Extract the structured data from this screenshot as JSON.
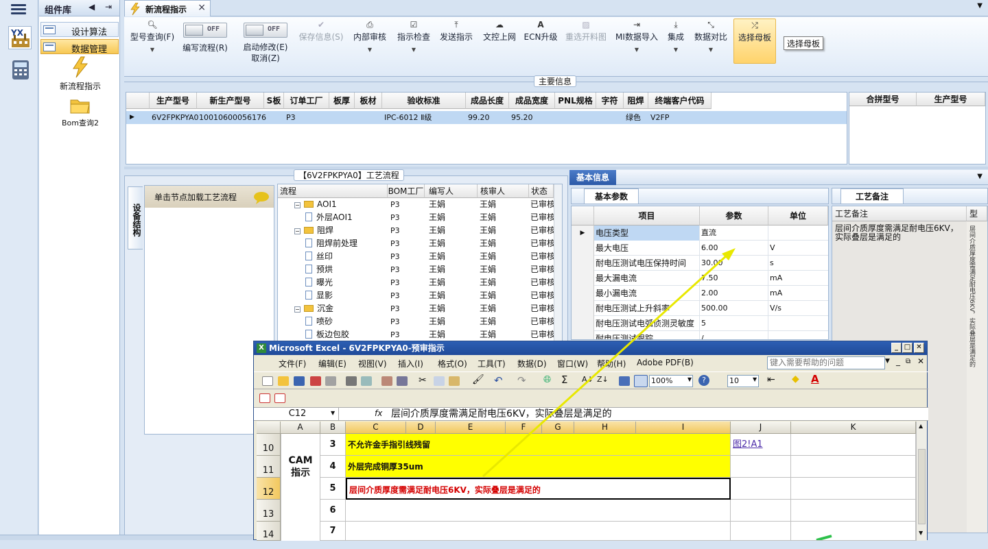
{
  "rail": {
    "icons": [
      "menu-icon",
      "yx-factory-icon",
      "calculator-icon"
    ]
  },
  "component_panel": {
    "title": "组件库",
    "items": [
      {
        "label": "设计算法"
      },
      {
        "label": "数据管理"
      }
    ],
    "tools": [
      {
        "label": "新流程指示"
      },
      {
        "label": "Bom查询2"
      }
    ]
  },
  "doc_tab": {
    "title": "新流程指示",
    "close": "×"
  },
  "ribbon": {
    "buttons": [
      {
        "label": "型号查询(F)"
      },
      {
        "label": "编写流程(R)"
      },
      {
        "label": "启动修改(E)",
        "label2": "取消(Z)"
      },
      {
        "label": "保存信息(S)"
      },
      {
        "label": "内部审核"
      },
      {
        "label": "指示检查"
      },
      {
        "label": "发送指示"
      },
      {
        "label": "文控上网"
      },
      {
        "label": "ECN升级"
      },
      {
        "label": "重选开料图"
      },
      {
        "label": "MI数据导入"
      },
      {
        "label": "集成"
      },
      {
        "label": "数据对比"
      },
      {
        "label": "选择母板"
      }
    ],
    "toggle_off": "OFF",
    "tooltip": "选择母板"
  },
  "main_info": {
    "title": "主要信息",
    "columns": [
      "生产型号",
      "新生产型号",
      "S板",
      "订单工厂",
      "板厚",
      "板材",
      "验收标准",
      "成品长度",
      "成品宽度",
      "PNL规格",
      "字符",
      "阻焊",
      "终端客户代码"
    ],
    "row": [
      "6V2FPKPYA0",
      "10010600056176",
      "",
      "P3",
      "",
      "",
      "IPC-6012 Ⅱ级",
      "99.20",
      "95.20",
      "",
      "",
      "绿色",
      "V2FP"
    ],
    "side_columns": [
      "合拼型号",
      "生产型号"
    ]
  },
  "process": {
    "title": "【6V2FPKPYA0】工艺流程",
    "side_tab": "设备结构",
    "hint": "单击节点加载工艺流程",
    "columns": [
      "流程",
      "BOM工厂",
      "编写人",
      "核审人",
      "状态"
    ],
    "rows": [
      {
        "name": "AOI1",
        "level": 0,
        "factory": "P3",
        "writer": "王娟",
        "reviewer": "王娟",
        "status": "已审核"
      },
      {
        "name": "外层AOI1",
        "level": 1,
        "factory": "P3",
        "writer": "王娟",
        "reviewer": "王娟",
        "status": "已审核"
      },
      {
        "name": "阻焊",
        "level": 0,
        "factory": "P3",
        "writer": "王娟",
        "reviewer": "王娟",
        "status": "已审核"
      },
      {
        "name": "阻焊前处理",
        "level": 1,
        "factory": "P3",
        "writer": "王娟",
        "reviewer": "王娟",
        "status": "已审核"
      },
      {
        "name": "丝印",
        "level": 1,
        "factory": "P3",
        "writer": "王娟",
        "reviewer": "王娟",
        "status": "已审核"
      },
      {
        "name": "预烘",
        "level": 1,
        "factory": "P3",
        "writer": "王娟",
        "reviewer": "王娟",
        "status": "已审核"
      },
      {
        "name": "曝光",
        "level": 1,
        "factory": "P3",
        "writer": "王娟",
        "reviewer": "王娟",
        "status": "已审核"
      },
      {
        "name": "显影",
        "level": 1,
        "factory": "P3",
        "writer": "王娟",
        "reviewer": "王娟",
        "status": "已审核"
      },
      {
        "name": "沉金",
        "level": 0,
        "factory": "P3",
        "writer": "王娟",
        "reviewer": "王娟",
        "status": "已审核"
      },
      {
        "name": "喷砂",
        "level": 1,
        "factory": "P3",
        "writer": "王娟",
        "reviewer": "王娟",
        "status": "已审核"
      },
      {
        "name": "板边包胶",
        "level": 1,
        "factory": "P3",
        "writer": "王娟",
        "reviewer": "王娟",
        "status": "已审核"
      }
    ]
  },
  "basic_info": {
    "tab": "基本信息",
    "subtab": "基本参数",
    "columns": [
      "项目",
      "参数",
      "单位"
    ],
    "rows": [
      {
        "item": "电压类型",
        "value": "直流",
        "unit": ""
      },
      {
        "item": "最大电压",
        "value": "6.00",
        "unit": "V"
      },
      {
        "item": "耐电压测试电压保持时间",
        "value": "30.00",
        "unit": "s"
      },
      {
        "item": "最大漏电流",
        "value": "7.50",
        "unit": "mA"
      },
      {
        "item": "最小漏电流",
        "value": "2.00",
        "unit": "mA"
      },
      {
        "item": "耐电压测试上升斜率",
        "value": "500.00",
        "unit": "V/s"
      },
      {
        "item": "耐电压测试电弧侦测灵敏度",
        "value": "5",
        "unit": ""
      },
      {
        "item": "耐电压测试跟踪",
        "value": "/",
        "unit": ""
      }
    ]
  },
  "process_notes": {
    "tab": "工艺备注",
    "header": "工艺备注",
    "header2": "型",
    "text": "层间介质厚度需满足耐电压6KV，实际叠层是满足的"
  },
  "excel": {
    "title": "Microsoft Excel - 6V2FPKPYA0-预审指示",
    "menu": [
      "文件(F)",
      "编辑(E)",
      "视图(V)",
      "插入(I)",
      "格式(O)",
      "工具(T)",
      "数据(D)",
      "窗口(W)",
      "帮助(H)",
      "Adobe PDF(B)"
    ],
    "help_placeholder": "键入需要帮助的问题",
    "zoom": "100%",
    "font_size": "10",
    "namebox": "C12",
    "fx": "fx",
    "formula": "层间介质厚度需满足耐电压6KV，实际叠层是满足的",
    "columns": [
      "A",
      "B",
      "C",
      "D",
      "E",
      "F",
      "G",
      "H",
      "I",
      "J",
      "K"
    ],
    "cam_label": "CAM\n指示",
    "rows": [
      {
        "num": "10",
        "b": "3",
        "text": "不允许金手指引线残留",
        "link": "图2!A1"
      },
      {
        "num": "11",
        "b": "4",
        "text": "外层完成铜厚35um",
        "link": ""
      },
      {
        "num": "12",
        "b": "5",
        "text": "层间介质厚度需满足耐电压6KV，实际叠层是满足的",
        "link": ""
      },
      {
        "num": "13",
        "b": "6",
        "text": "",
        "link": ""
      },
      {
        "num": "14",
        "b": "7",
        "text": "",
        "link": ""
      }
    ]
  },
  "colors": {
    "highlight_yellow": "#ffff00",
    "red_text": "#d40000",
    "accent": "#f7c853"
  }
}
